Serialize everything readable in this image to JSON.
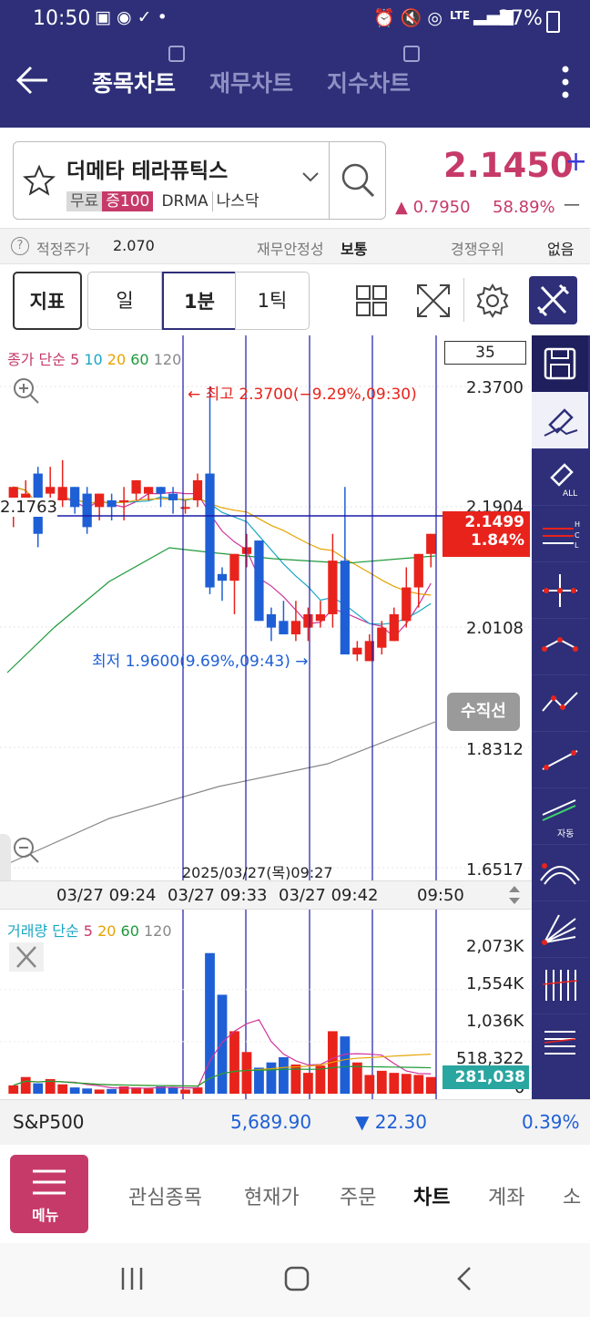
{
  "status_bar": {
    "time": "10:50",
    "battery": "27%",
    "lte": "LTE"
  },
  "header": {
    "tabs": [
      {
        "label": "종목차트",
        "active": true
      },
      {
        "label": "재무차트",
        "active": false
      },
      {
        "label": "지수차트",
        "active": false
      }
    ]
  },
  "stock": {
    "name": "더메타 테라퓨틱스",
    "tags": [
      "무료",
      "증100",
      "DRMA",
      "나스닥"
    ],
    "price": "2.1450",
    "price_suffix": "+",
    "change": "▲ 0.7950",
    "change_pct": "58.89%",
    "dash": "—"
  },
  "info_row": {
    "fair_price_label": "적정주가",
    "fair_price_value": "2.070",
    "financial_label": "재무안정성",
    "financial_value": "보통",
    "competition_label": "경쟁우위",
    "competition_value": "없음"
  },
  "toolbar": {
    "indicator": "지표",
    "period_day": "일",
    "period_min": "1분",
    "period_tick": "1틱"
  },
  "chart": {
    "legend_prefix": "종가 단순",
    "ma": [
      "5",
      "10",
      "20",
      "60",
      "120"
    ],
    "count_box": "35",
    "y_labels": [
      "2.3700",
      "2.1904",
      "2.0108",
      "1.8312",
      "1.6517"
    ],
    "crosshair_value": "2.1763",
    "current_price": "2.1499",
    "current_pct": "1.84%",
    "high_annotation": "← 최고 2.3700(−9.29%,09:30)",
    "low_annotation": "최저 1.9600(9.69%,09:43) →",
    "vertical_line_button": "수직선",
    "date_overlay": "2025/03/27(목)09:27",
    "x_labels": [
      "03/27 09:24",
      "03/27 09:33",
      "03/27 09:42",
      "09:50"
    ],
    "colors": {
      "up": "#e8231c",
      "down": "#1f5fd6",
      "header": "#2e2f78",
      "accent": "#c63a6a"
    }
  },
  "volume": {
    "legend_prefix": "거래량 단순",
    "ma": [
      "5",
      "20",
      "60",
      "120"
    ],
    "y_labels": [
      "2,073K",
      "1,554K",
      "1,036K",
      "518,322",
      "0"
    ],
    "current": "281,038"
  },
  "chart_data": {
    "type": "candlestick",
    "x_ticks": [
      "03/27 09:24",
      "03/27 09:33",
      "03/27 09:42",
      "09:50"
    ],
    "y_ticks": [
      2.37,
      2.1904,
      2.0108,
      1.8312,
      1.6517
    ],
    "ohlc": [
      [
        2.19,
        2.22,
        2.16,
        2.22
      ],
      [
        2.2,
        2.23,
        2.18,
        2.21
      ],
      [
        2.24,
        2.25,
        2.13,
        2.15
      ],
      [
        2.21,
        2.25,
        2.19,
        2.22
      ],
      [
        2.2,
        2.26,
        2.19,
        2.22
      ],
      [
        2.22,
        2.22,
        2.18,
        2.19
      ],
      [
        2.21,
        2.22,
        2.15,
        2.16
      ],
      [
        2.19,
        2.21,
        2.17,
        2.21
      ],
      [
        2.2,
        2.21,
        2.17,
        2.19
      ],
      [
        2.2,
        2.22,
        2.17,
        2.2
      ],
      [
        2.21,
        2.23,
        2.2,
        2.23
      ],
      [
        2.21,
        2.22,
        2.2,
        2.22
      ],
      [
        2.22,
        2.22,
        2.19,
        2.21
      ],
      [
        2.21,
        2.22,
        2.18,
        2.2
      ],
      [
        2.19,
        2.2,
        2.18,
        2.19
      ],
      [
        2.2,
        2.24,
        2.19,
        2.23
      ],
      [
        2.24,
        2.37,
        2.06,
        2.07
      ],
      [
        2.09,
        2.1,
        2.05,
        2.08
      ],
      [
        2.08,
        2.12,
        2.03,
        2.12
      ],
      [
        2.12,
        2.15,
        2.1,
        2.13
      ],
      [
        2.14,
        2.14,
        2.02,
        2.02
      ],
      [
        2.03,
        2.04,
        1.99,
        2.01
      ],
      [
        2.02,
        2.05,
        2.0,
        2.0
      ],
      [
        2.0,
        2.05,
        1.99,
        2.02
      ],
      [
        2.01,
        2.04,
        1.99,
        2.03
      ],
      [
        2.02,
        2.05,
        2.01,
        2.03
      ],
      [
        2.03,
        2.15,
        2.01,
        2.11
      ],
      [
        2.11,
        2.22,
        1.97,
        1.97
      ],
      [
        1.97,
        1.99,
        1.96,
        1.98
      ],
      [
        1.96,
        2.0,
        1.96,
        1.99
      ],
      [
        1.98,
        2.02,
        1.97,
        2.01
      ],
      [
        1.99,
        2.04,
        1.99,
        2.03
      ],
      [
        2.02,
        2.1,
        2.01,
        2.07
      ],
      [
        2.07,
        2.12,
        2.04,
        2.12
      ],
      [
        2.12,
        2.15,
        2.1,
        2.15
      ]
    ],
    "volume": [
      80,
      160,
      100,
      140,
      90,
      60,
      50,
      40,
      45,
      70,
      60,
      50,
      70,
      60,
      40,
      60,
      1350,
      950,
      600,
      400,
      250,
      300,
      350,
      280,
      200,
      270,
      600,
      550,
      300,
      180,
      220,
      200,
      190,
      180,
      160
    ],
    "high": {
      "value": 2.37,
      "label": "최고 2.3700(−9.29%,09:30)"
    },
    "low": {
      "value": 1.96,
      "label": "최저 1.9600(9.69%,09:43)"
    },
    "last": 2.1499
  },
  "index_bar": {
    "name": "S&P500",
    "value": "5,689.90",
    "change": "▼ 22.30",
    "pct": "0.39%"
  },
  "bottom_nav": {
    "menu": "메뉴",
    "items": [
      "관심종목",
      "현재가",
      "주문",
      "차트",
      "계좌",
      "소"
    ],
    "active": "차트"
  }
}
